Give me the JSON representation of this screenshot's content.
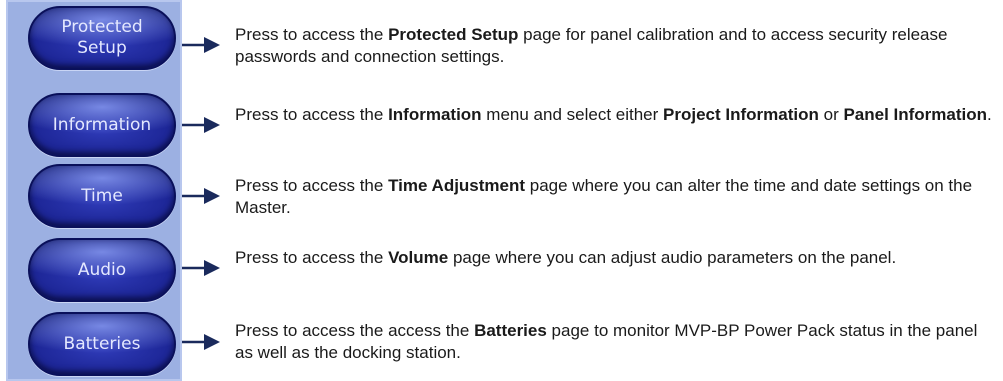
{
  "buttons": [
    {
      "label": "Protected\nSetup"
    },
    {
      "label": "Information"
    },
    {
      "label": "Time"
    },
    {
      "label": "Audio"
    },
    {
      "label": "Batteries"
    }
  ],
  "descriptions": [
    {
      "pre": "Press to access the ",
      "b1": "Protected Setup",
      "mid": " page for panel calibration and to access security release passwords and connection settings."
    },
    {
      "pre": "Press to access the ",
      "b1": "Information",
      "mid": " menu and select either ",
      "b2": "Project Information",
      "mid2": " or ",
      "b3": "Panel Information",
      "post": "."
    },
    {
      "pre": "Press to access the ",
      "b1": "Time Adjustment",
      "mid": " page where you can alter the time and date settings on the Master."
    },
    {
      "pre": "Press to access the ",
      "b1": "Volume",
      "mid": " page where you can adjust audio parameters on the panel."
    },
    {
      "pre": "Press to access the access the ",
      "b1": "Batteries",
      "mid": " page to monitor MVP-BP Power Pack status in the panel as well as the docking station."
    }
  ],
  "colors": {
    "panel_bg": "#9cb0e2",
    "button_blue": "#1c2595",
    "arrow_navy": "#1a2a5c"
  },
  "icons": [
    "arrow-right-icon"
  ]
}
